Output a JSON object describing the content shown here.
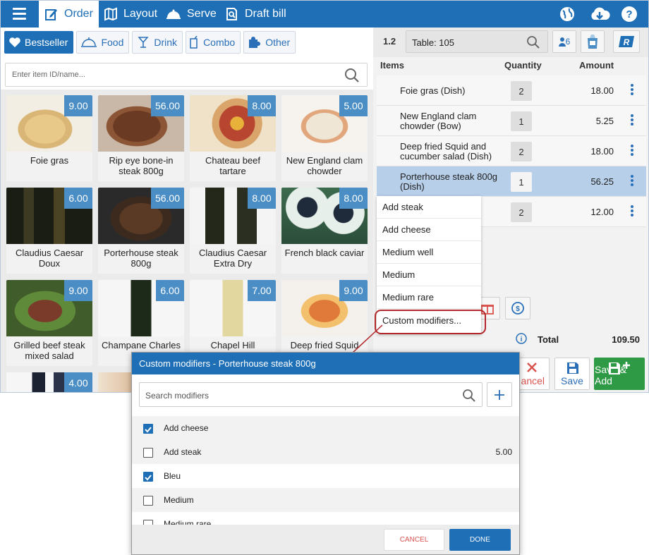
{
  "nav": {
    "tabs": [
      {
        "label": "Order",
        "icon": "edit-icon"
      },
      {
        "label": "Layout",
        "icon": "map-icon"
      },
      {
        "label": "Serve",
        "icon": "cloche-icon"
      },
      {
        "label": "Draft bill",
        "icon": "bill-search-icon"
      }
    ],
    "right_icons": [
      "globe-icon",
      "cloud-download-icon",
      "help-icon"
    ]
  },
  "categories": [
    {
      "label": "Bestseller",
      "icon": "heart-icon"
    },
    {
      "label": "Food",
      "icon": "cloche-icon"
    },
    {
      "label": "Drink",
      "icon": "cocktail-icon"
    },
    {
      "label": "Combo",
      "icon": "combo-icon"
    },
    {
      "label": "Other",
      "icon": "puzzle-icon"
    }
  ],
  "item_search": {
    "placeholder": "Enter item ID/name..."
  },
  "items": [
    {
      "name": "Foie gras",
      "price": "9.00"
    },
    {
      "name": "Rip eye bone-in steak 800g",
      "price": "56.00"
    },
    {
      "name": "Chateau beef tartare",
      "price": "8.00"
    },
    {
      "name": "New England clam chowder",
      "price": "5.00"
    },
    {
      "name": "Claudius Caesar Doux",
      "price": "6.00"
    },
    {
      "name": "Porterhouse steak 800g",
      "price": "56.00"
    },
    {
      "name": "Claudius Caesar Extra Dry",
      "price": "8.00"
    },
    {
      "name": "French black caviar",
      "price": "8.00"
    },
    {
      "name": "Grilled beef steak mixed salad",
      "price": "9.00"
    },
    {
      "name": "Champane Charles W",
      "price": "6.00"
    },
    {
      "name": "Chapel Hill",
      "price": "7.00"
    },
    {
      "name": "Deep fried Squid and",
      "price": "9.00"
    },
    {
      "name": "",
      "price": "4.00"
    }
  ],
  "order": {
    "number": "1.2",
    "table": "Table: 105",
    "guests": "6",
    "r_label": "R",
    "columns": {
      "items": "Items",
      "quantity": "Quantity",
      "amount": "Amount"
    },
    "lines": [
      {
        "name": "Foie gras (Dish)",
        "qty": "2",
        "amount": "18.00"
      },
      {
        "name": "New England clam chowder (Bow)",
        "qty": "1",
        "amount": "5.25"
      },
      {
        "name": "Deep fried Squid and cucumber salad (Dish)",
        "qty": "2",
        "amount": "18.00"
      },
      {
        "name": "Porterhouse steak 800g (Dish)",
        "qty": "1",
        "amount": "56.25"
      },
      {
        "name": "",
        "qty": "2",
        "amount": "12.00"
      }
    ],
    "total_label": "Total",
    "total": "109.50"
  },
  "context_menu": [
    "Add steak",
    "Add cheese",
    "Medium well",
    "Medium",
    "Medium rare",
    "Custom modifiers..."
  ],
  "actions": {
    "cancel": "ancel",
    "save": "Save",
    "save_add": "Save & Add"
  },
  "dialog": {
    "title": "Custom modifiers - Porterhouse steak 800g",
    "search_placeholder": "Search modifiers",
    "modifiers": [
      {
        "label": "Add cheese",
        "checked": true,
        "price": ""
      },
      {
        "label": "Add steak",
        "checked": false,
        "price": "5.00"
      },
      {
        "label": "Bleu",
        "checked": true,
        "price": ""
      },
      {
        "label": "Medium",
        "checked": false,
        "price": ""
      },
      {
        "label": "Medium rare",
        "checked": false,
        "price": ""
      }
    ],
    "cancel_label": "CANCEL",
    "done_label": "DONE"
  },
  "colors": {
    "primary": "#1e6fb6",
    "price_badge": "#4b8ec6",
    "selected_row": "#b7cfe9",
    "save_add": "#2e9a45",
    "highlight": "#b2282a"
  }
}
